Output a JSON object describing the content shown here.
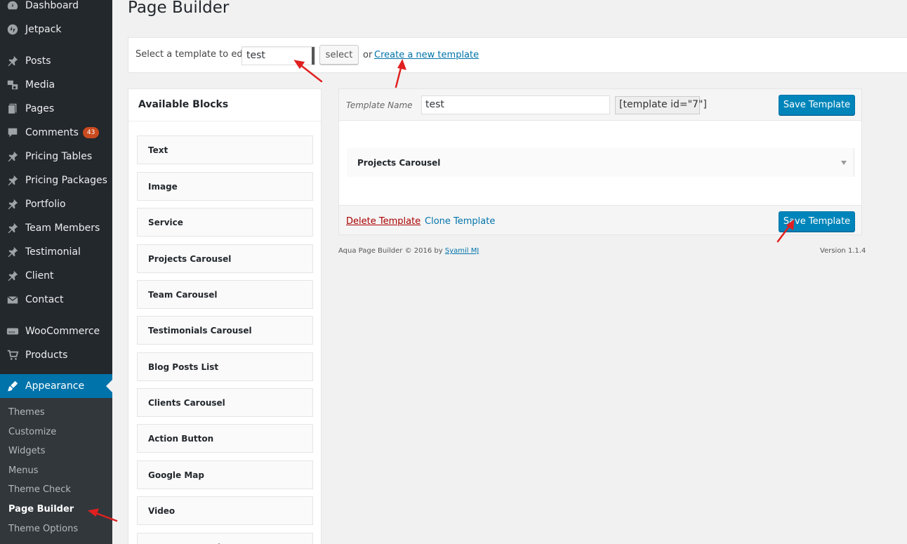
{
  "sidebar": {
    "items": [
      {
        "label": "Dashboard",
        "icon": "dashboard-icon"
      },
      {
        "label": "Jetpack",
        "icon": "jetpack-icon"
      },
      {
        "label": "Posts",
        "icon": "pin-icon"
      },
      {
        "label": "Media",
        "icon": "media-icon"
      },
      {
        "label": "Pages",
        "icon": "pages-icon"
      },
      {
        "label": "Comments",
        "icon": "comments-icon",
        "badge": "43"
      },
      {
        "label": "Pricing Tables",
        "icon": "pin-icon"
      },
      {
        "label": "Pricing Packages",
        "icon": "pin-icon"
      },
      {
        "label": "Portfolio",
        "icon": "pin-icon"
      },
      {
        "label": "Team Members",
        "icon": "pin-icon"
      },
      {
        "label": "Testimonial",
        "icon": "pin-icon"
      },
      {
        "label": "Client",
        "icon": "pin-icon"
      },
      {
        "label": "Contact",
        "icon": "mail-icon"
      },
      {
        "label": "WooCommerce",
        "icon": "woo-icon"
      },
      {
        "label": "Products",
        "icon": "cart-icon"
      },
      {
        "label": "Appearance",
        "icon": "brush-icon"
      }
    ],
    "submenu": [
      "Themes",
      "Customize",
      "Widgets",
      "Menus",
      "Theme Check",
      "Page Builder",
      "Theme Options"
    ],
    "current_submenu": "Page Builder"
  },
  "header": {
    "title": "Page Builder"
  },
  "template_bar": {
    "label": "Select a template to edit:",
    "selected": "test",
    "select_button": "select",
    "or": "or",
    "create_link": "Create a new template"
  },
  "blocks": {
    "title": "Available Blocks",
    "items": [
      "Text",
      "Image",
      "Service",
      "Projects Carousel",
      "Team Carousel",
      "Testimonials Carousel",
      "Blog Posts List",
      "Clients Carousel",
      "Action Button",
      "Google Map",
      "Video",
      "Route Carousel"
    ]
  },
  "template": {
    "name_label": "Template Name",
    "name_value": "test",
    "shortcode": "[template id=\"7\"]",
    "save_label": "Save Template",
    "block": "Projects Carousel",
    "delete_label": "Delete Template",
    "clone_label": "Clone Template"
  },
  "footer": {
    "credits": "Aqua Page Builder © 2016 by",
    "author": "Syamil MJ",
    "version": "Version 1.1.4"
  },
  "colors": {
    "sidebar_bg": "#23282d",
    "accent": "#0073aa",
    "button_primary": "#0085ba",
    "delete": "#aa0000",
    "badge": "#ca4a1f",
    "annotation": "#e02020"
  }
}
